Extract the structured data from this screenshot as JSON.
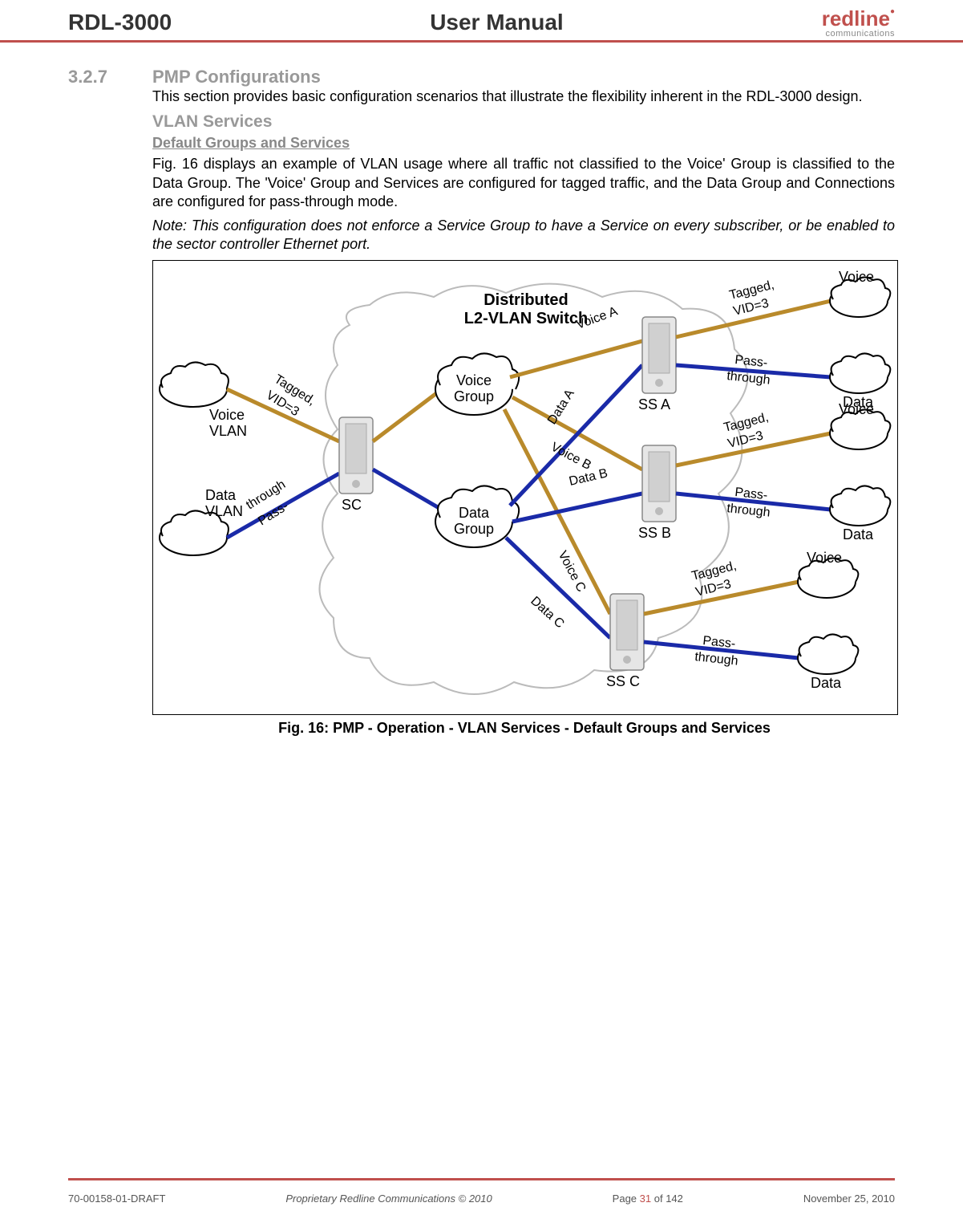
{
  "header": {
    "model": "RDL-3000",
    "doc_type": "User Manual",
    "logo_text": "redline",
    "logo_sub": "communications"
  },
  "section": {
    "number": "3.2.7",
    "title": "PMP Configurations",
    "intro": "This section provides basic configuration scenarios that illustrate the flexibility inherent in the RDL-3000 design.",
    "sub1": "VLAN Services",
    "sub2": "Default Groups and Services",
    "body": "Fig. 16 displays an example of VLAN usage where all traffic not classified to the Voice' Group is classified to the Data Group. The 'Voice' Group and Services are configured for tagged traffic, and the Data Group and Connections are configured for pass-through mode.",
    "note": "Note: This configuration does not enforce a Service Group to have a Service on every subscriber, or be enabled to the sector controller Ethernet port."
  },
  "figure": {
    "caption": "Fig. 16: PMP - Operation - VLAN Services - Default Groups and Services",
    "title1": "Distributed",
    "title2": "L2-VLAN Switch",
    "voice_vlan": "Voice\nVLAN",
    "data_vlan": "Data\nVLAN",
    "tagged_vid": "Tagged,\nVID=3",
    "pass_through": "Pass-\nthrough",
    "sc": "SC",
    "voice_group": "Voice\nGroup",
    "data_group": "Data\nGroup",
    "voice_a": "Voice A",
    "data_a": "Data A",
    "voice_b": "Voice B",
    "data_b": "Data B",
    "voice_c": "Voice C",
    "data_c": "Data C",
    "ss_a": "SS A",
    "ss_b": "SS B",
    "ss_c": "SS C",
    "voice": "Voice",
    "data": "Data"
  },
  "footer": {
    "left": "70-00158-01-DRAFT",
    "center": "Proprietary Redline Communications © 2010",
    "page_label": "Page ",
    "page_cur": "31",
    "page_of": " of 142",
    "date": "November 25, 2010"
  }
}
